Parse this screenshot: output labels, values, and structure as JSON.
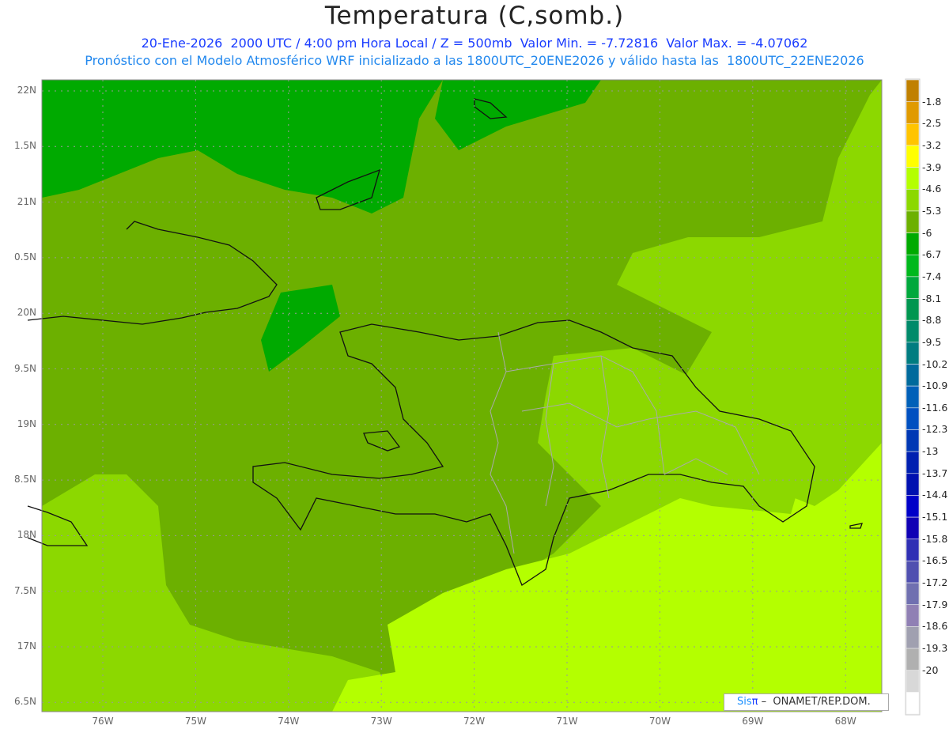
{
  "title": "Temperatura (C,somb.)",
  "subtitle_line1": "20-Ene-2026  2000 UTC / 4:00 pm Hora Local / Z = 500mb  Valor Min. = -7.72816  Valor Max. = -4.07062",
  "subtitle_line2": "Pronóstico con el Modelo Atmosférico WRF inicializado a las 1800UTC_20ENE2026 y válido hasta las  1800UTC_22ENE2026",
  "y_axis_labels": [
    "22N",
    "1.5N",
    "21N",
    "0.5N",
    "20N",
    "9.5N",
    "19N",
    "8.5N",
    "18N",
    "7.5N",
    "17N",
    "6.5N"
  ],
  "x_axis_labels": [
    "76W",
    "75W",
    "74W",
    "73W",
    "72W",
    "71W",
    "70W",
    "69W",
    "68W"
  ],
  "colorbar": {
    "labels": [
      "-1.8",
      "-2.5",
      "-3.2",
      "-3.9",
      "-4.6",
      "-5.3",
      "-6",
      "-6.7",
      "-7.4",
      "-8.1",
      "-8.8",
      "-9.5",
      "-10.2",
      "-10.9",
      "-11.6",
      "-12.3",
      "-13",
      "-13.7",
      "-14.4",
      "-15.1",
      "-15.8",
      "-16.5",
      "-17.2",
      "-17.9",
      "-18.6",
      "-19.3",
      "-20"
    ],
    "colors": [
      "#c08000",
      "#e09a00",
      "#ffc400",
      "#ffff00",
      "#b4ff00",
      "#8cd800",
      "#6cb000",
      "#00aa00",
      "#00b81c",
      "#00a83c",
      "#009650",
      "#008a6a",
      "#007c80",
      "#006a9c",
      "#0060b8",
      "#0050c0",
      "#0038b4",
      "#0020b0",
      "#0010b0",
      "#0000c8",
      "#1000b4",
      "#3030b4",
      "#5050b0",
      "#7070b0",
      "#9080b4",
      "#a0a0b0",
      "#b0b0b0",
      "#d8d8d8",
      "#ffffff"
    ]
  },
  "credit": {
    "sis": "Sis",
    "pi": "π",
    "text": " –  ONAMET/REP.DOM."
  }
}
